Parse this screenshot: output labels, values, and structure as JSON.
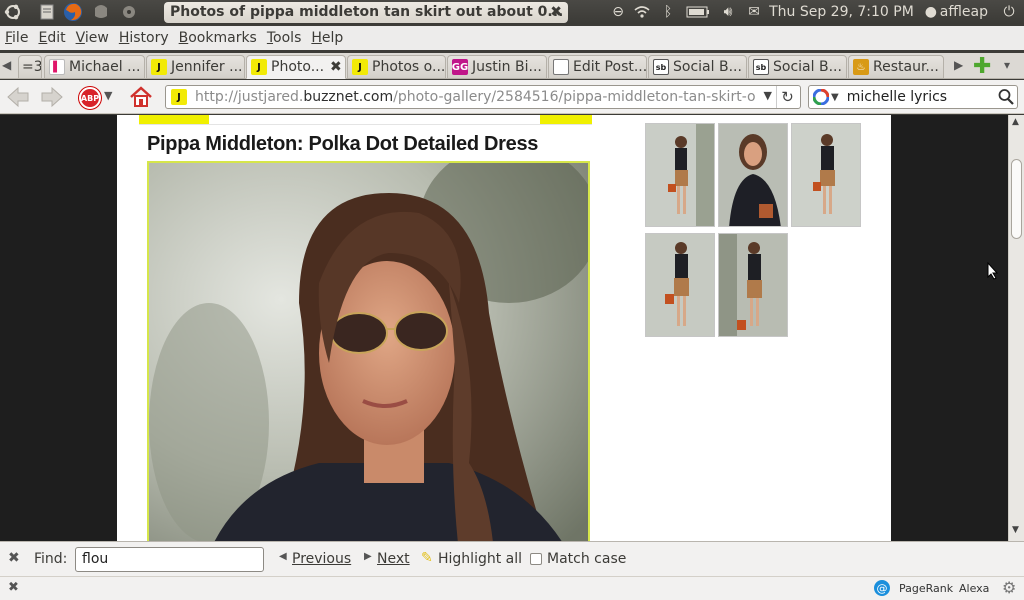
{
  "panel": {
    "window_title": "Photos of pippa middleton tan skirt out about 0...",
    "datetime": "Thu Sep 29,  7:10 PM",
    "username": "affleap"
  },
  "menu": [
    "File",
    "Edit",
    "View",
    "History",
    "Bookmarks",
    "Tools",
    "Help"
  ],
  "tabs": [
    {
      "label": "=3"
    },
    {
      "label": "Michael ..."
    },
    {
      "label": "Jennifer ..."
    },
    {
      "label": "Photo..."
    },
    {
      "label": "Photos o..."
    },
    {
      "label": "Justin Bi..."
    },
    {
      "label": "Edit Post..."
    },
    {
      "label": "Social B..."
    },
    {
      "label": "Social B..."
    },
    {
      "label": "Restaur..."
    }
  ],
  "tab_icons": {
    "jj": "J",
    "gg": "GG",
    "sb": "sb"
  },
  "navbar": {
    "abp_label": "ABP",
    "url_prefix": "http://justjared.",
    "url_domain": "buzznet.com",
    "url_rest": "/photo-gallery/2584516/pippa-middleton-tan-skirt-out-a",
    "search_value": "michelle lyrics"
  },
  "page": {
    "photo_title": "Pippa Middleton: Polka Dot Detailed Dress",
    "thumbnails": [
      "thumb-1",
      "thumb-2",
      "thumb-3",
      "thumb-4",
      "thumb-5"
    ]
  },
  "findbar": {
    "find_label": "Find:",
    "find_value": "flou",
    "previous_label": "Previous",
    "next_label": "Next",
    "highlight_label": "Highlight all",
    "match_case_label": "Match case"
  },
  "statusbar": {
    "pagerank_label": "PageRank",
    "alexa_label": "Alexa"
  }
}
